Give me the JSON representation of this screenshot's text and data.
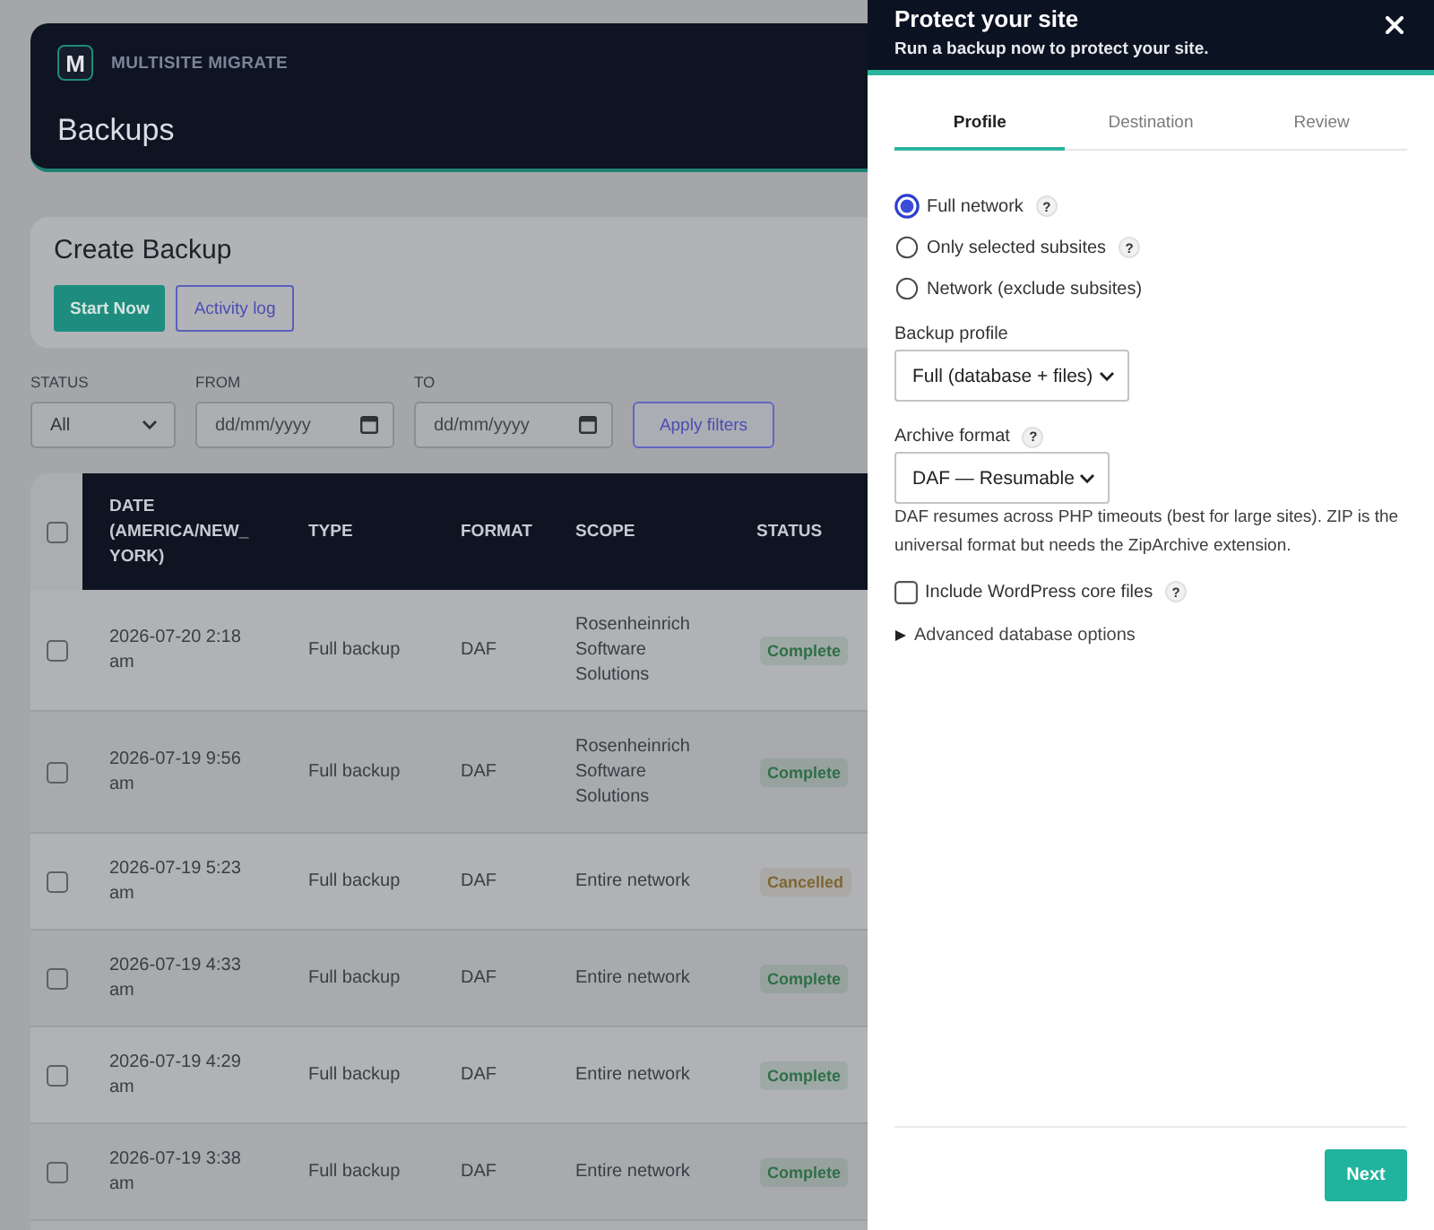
{
  "app_header": {
    "logo_letter": "M",
    "brand": "MULTISITE MIGRATE",
    "title": "Backups"
  },
  "create_backup": {
    "title": "Create Backup",
    "buttons": [
      {
        "label": "Start Now",
        "kind": "primary"
      },
      {
        "label": "Activity log",
        "kind": "outline"
      }
    ]
  },
  "filters": {
    "fields": [
      {
        "label": "STATUS",
        "kind": "select",
        "value": "All"
      },
      {
        "label": "FROM",
        "kind": "date",
        "placeholder": "dd/mm/yyyy"
      },
      {
        "label": "TO",
        "kind": "date",
        "placeholder": "dd/mm/yyyy"
      }
    ],
    "apply_button": "Apply filters"
  },
  "table": {
    "select_all_checked": false,
    "columns": [
      "DATE (AMERICA/NEW_YORK)",
      "TYPE",
      "FORMAT",
      "SCOPE",
      "STATUS"
    ],
    "rows": [
      {
        "checked": false,
        "date": "2026-07-20 2:18 am",
        "type": "Full backup",
        "format": "DAF",
        "scope": "Rosenheinrich Software Solutions",
        "status": {
          "label": "Complete",
          "color": "#2f6f46"
        }
      },
      {
        "checked": false,
        "date": "2026-07-19 9:56 am",
        "type": "Full backup",
        "format": "DAF",
        "scope": "Rosenheinrich Software Solutions",
        "status": {
          "label": "Complete",
          "color": "#2f6f46"
        }
      },
      {
        "checked": false,
        "date": "2026-07-19 5:23 am",
        "type": "Full backup",
        "format": "DAF",
        "scope": "Entire network",
        "status": {
          "label": "Cancelled",
          "color": "#7d6633"
        }
      },
      {
        "checked": false,
        "date": "2026-07-19 4:33 am",
        "type": "Full backup",
        "format": "DAF",
        "scope": "Entire network",
        "status": {
          "label": "Complete",
          "color": "#2f6f46"
        }
      },
      {
        "checked": false,
        "date": "2026-07-19 4:29 am",
        "type": "Full backup",
        "format": "DAF",
        "scope": "Entire network",
        "status": {
          "label": "Complete",
          "color": "#2f6f46"
        }
      },
      {
        "checked": false,
        "date": "2026-07-19 3:38 am",
        "type": "Full backup",
        "format": "DAF",
        "scope": "Entire network",
        "status": {
          "label": "Complete",
          "color": "#2f6f46"
        }
      }
    ]
  },
  "drawer": {
    "title": "Protect your site",
    "subtitle": "Run a backup now to protect your site.",
    "tabs": [
      {
        "label": "Profile",
        "selected": true
      },
      {
        "label": "Destination",
        "selected": false
      },
      {
        "label": "Review",
        "selected": false
      }
    ],
    "scope_options": [
      {
        "label": "Full network",
        "selected": true,
        "help": "?"
      },
      {
        "label": "Only selected subsites",
        "selected": false,
        "help": "?"
      },
      {
        "label": "Network (exclude subsites)",
        "selected": false
      }
    ],
    "backup_profile": {
      "label": "Backup profile",
      "value": "Full (database + files)"
    },
    "archive_format": {
      "label": "Archive format",
      "help": "?",
      "value": "DAF — Resumable",
      "description": "DAF resumes across PHP timeouts (best for large sites). ZIP is the universal format but needs the ZipArchive extension."
    },
    "include_core": {
      "label": "Include WordPress core files",
      "checked": false,
      "help": "?"
    },
    "advanced": {
      "label": "Advanced database options",
      "expanded": false
    },
    "next_button": "Next"
  }
}
